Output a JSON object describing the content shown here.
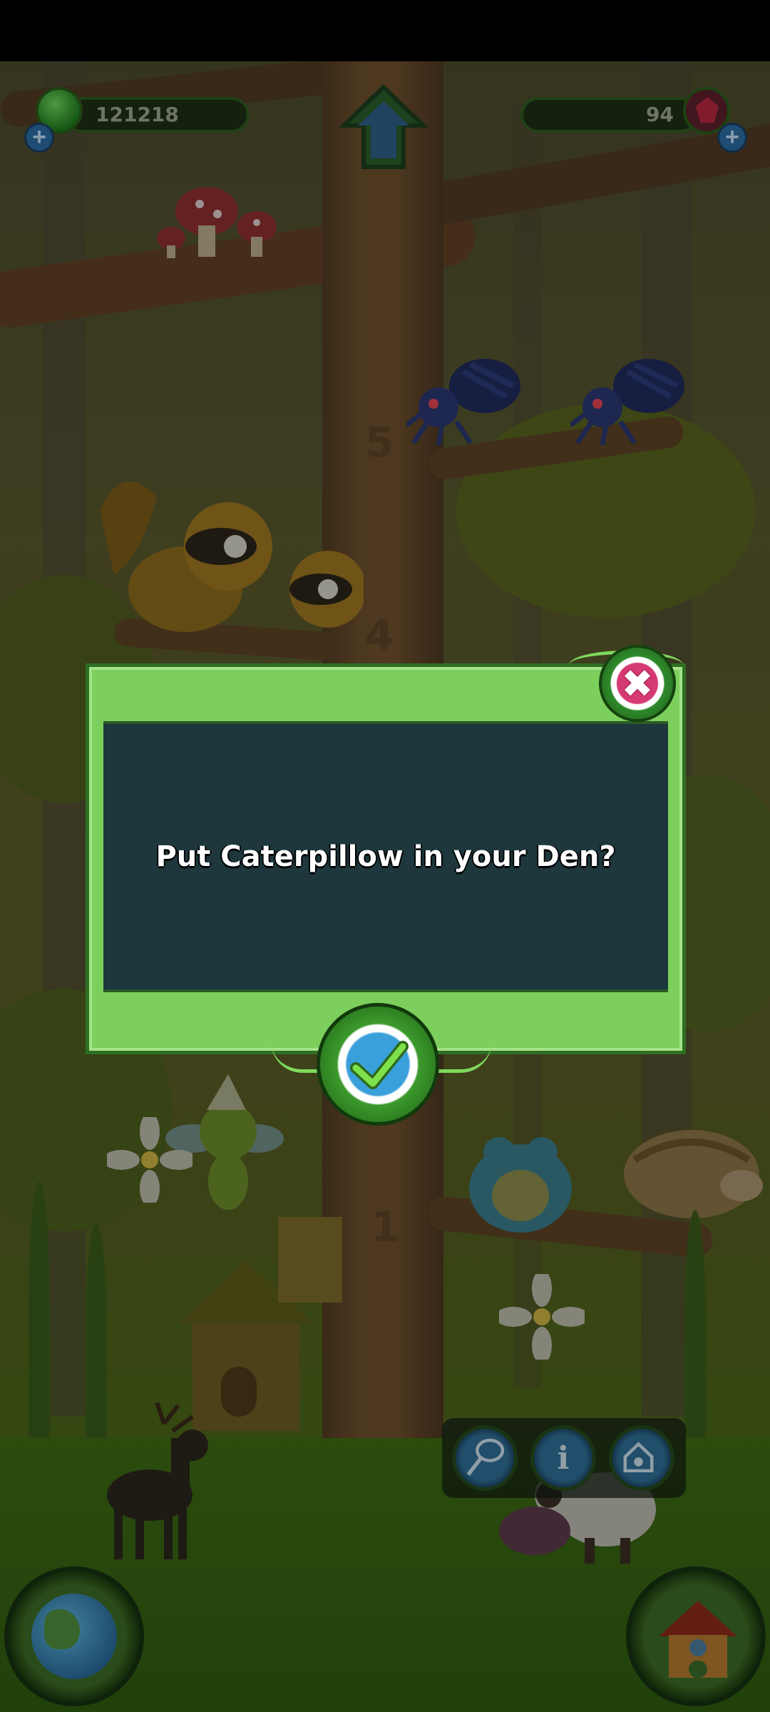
{
  "hud": {
    "coins": "121218",
    "gems": "94"
  },
  "tree_levels": [
    "5",
    "4",
    "1"
  ],
  "dialog": {
    "message": "Put Caterpillow in your Den?"
  },
  "icons": {
    "close": "close-icon",
    "confirm": "checkmark-icon",
    "home": "home-arrow-icon",
    "net": "butterfly-net-icon",
    "info": "info-icon",
    "den": "den-house-icon",
    "world": "globe-icon",
    "house": "treehouse-icon"
  },
  "info_glyph": "i",
  "close_glyph": "✖",
  "add_glyph": "+",
  "colors": {
    "dialog_frame": "#7ccf5d",
    "dialog_panel": "#1d373d",
    "close_accent": "#d63a74",
    "confirm_accent": "#3aa0dc"
  }
}
